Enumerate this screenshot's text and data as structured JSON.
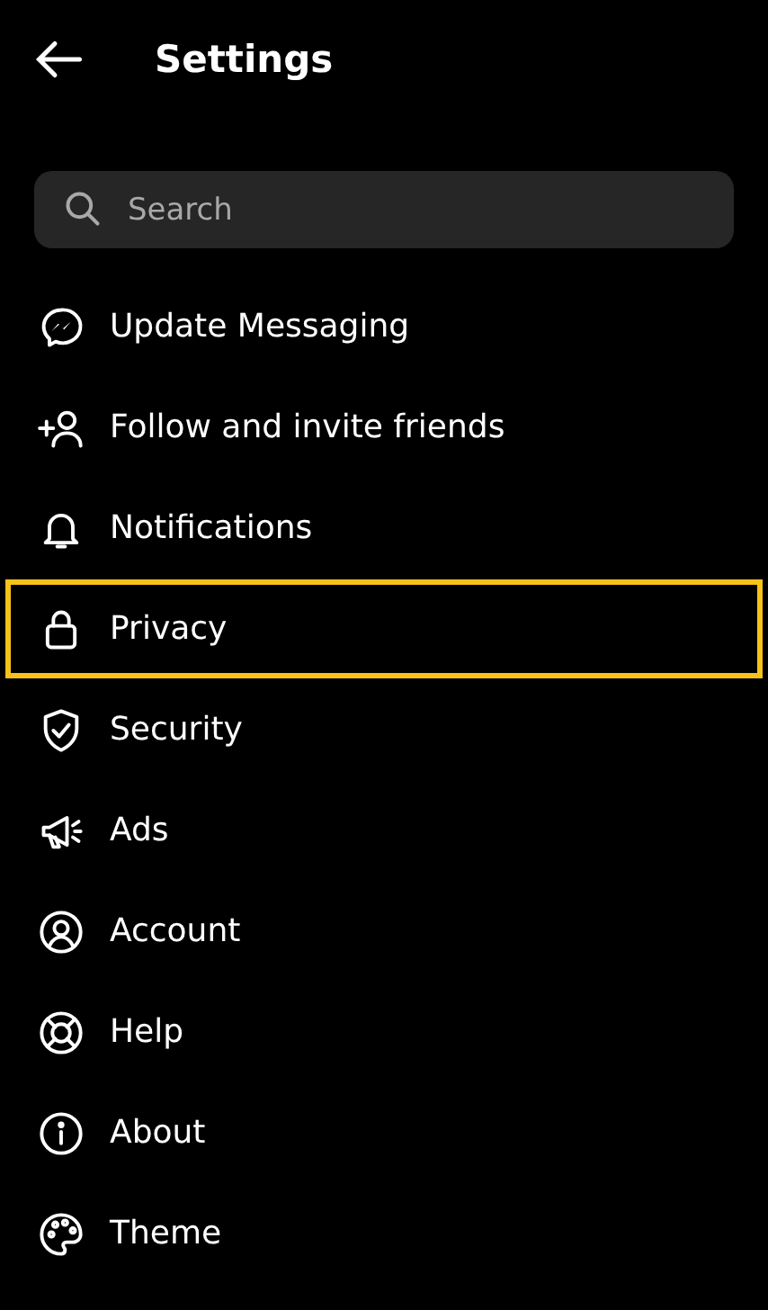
{
  "header": {
    "title": "Settings"
  },
  "search": {
    "placeholder": "Search"
  },
  "items": [
    {
      "label": "Update Messaging",
      "highlighted": false
    },
    {
      "label": "Follow and invite friends",
      "highlighted": false
    },
    {
      "label": "Notifications",
      "highlighted": false
    },
    {
      "label": "Privacy",
      "highlighted": true
    },
    {
      "label": "Security",
      "highlighted": false
    },
    {
      "label": "Ads",
      "highlighted": false
    },
    {
      "label": "Account",
      "highlighted": false
    },
    {
      "label": "Help",
      "highlighted": false
    },
    {
      "label": "About",
      "highlighted": false
    },
    {
      "label": "Theme",
      "highlighted": false
    }
  ]
}
